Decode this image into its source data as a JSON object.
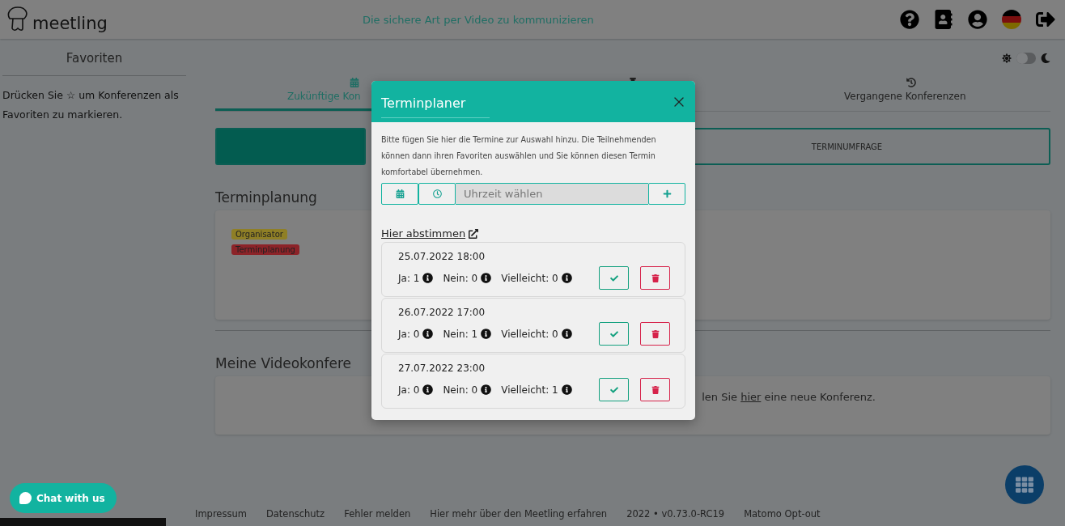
{
  "header": {
    "logo_text": "meetling",
    "tagline": "Die sichere Art per Video zu kommunizieren"
  },
  "sidebar": {
    "title": "Favoriten",
    "hint": "Drücken Sie ☆ um Konferenzen als Favoriten zu markieren."
  },
  "theme_toggle": {
    "on": false
  },
  "tabs": [
    {
      "kind": "calendar",
      "label": "Zukünftige Kon",
      "selected": true
    },
    {
      "kind": "pin",
      "selected": false
    },
    {
      "kind": "history",
      "label": "Vergangene Konferenzen",
      "selected": false
    }
  ],
  "mode_buttons": [
    {
      "selected": true
    },
    {
      "label": "TERMINUMFRAGE",
      "selected": false
    }
  ],
  "planning": {
    "heading": "Terminplanung",
    "badges": [
      {
        "label": "Organisator",
        "color": "#8f7f26"
      },
      {
        "label": "Terminplanung",
        "color": "#8c2328"
      }
    ]
  },
  "conferences": {
    "heading": "Meine Videokonfere",
    "empty_text": "len Sie **hier** eine neue Konferenz."
  },
  "modal": {
    "title": "Terminplaner",
    "intro": "Bitte fügen Sie hier die Termine zur Auswahl hinzu. Die Teilnehmenden können dann ihren Favoriten auswählen und Sie können diesen Termin komfortabel übernehmen.",
    "time_placeholder": "Uhrzeit wählen",
    "vote_link": "Hier abstimmen",
    "options": [
      {
        "date": "25.07.2022 18:00",
        "votes": [
          "Ja: 1",
          "Nein: 0",
          "Vielleicht: 0"
        ]
      },
      {
        "date": "26.07.2022 17:00",
        "votes": [
          "Ja: 0",
          "Nein: 1",
          "Vielleicht: 0"
        ]
      },
      {
        "date": "27.07.2022 23:00",
        "votes": [
          "Ja: 0",
          "Nein: 0",
          "Vielleicht: 1"
        ]
      }
    ]
  },
  "chat_button": "Chat with us",
  "footer": [
    "Impressum",
    "Datenschutz",
    "Fehler melden",
    "Hier mehr über den Meetling erfahren",
    "2022 • v0.73.0-RC19",
    "Matomo Opt-out"
  ]
}
